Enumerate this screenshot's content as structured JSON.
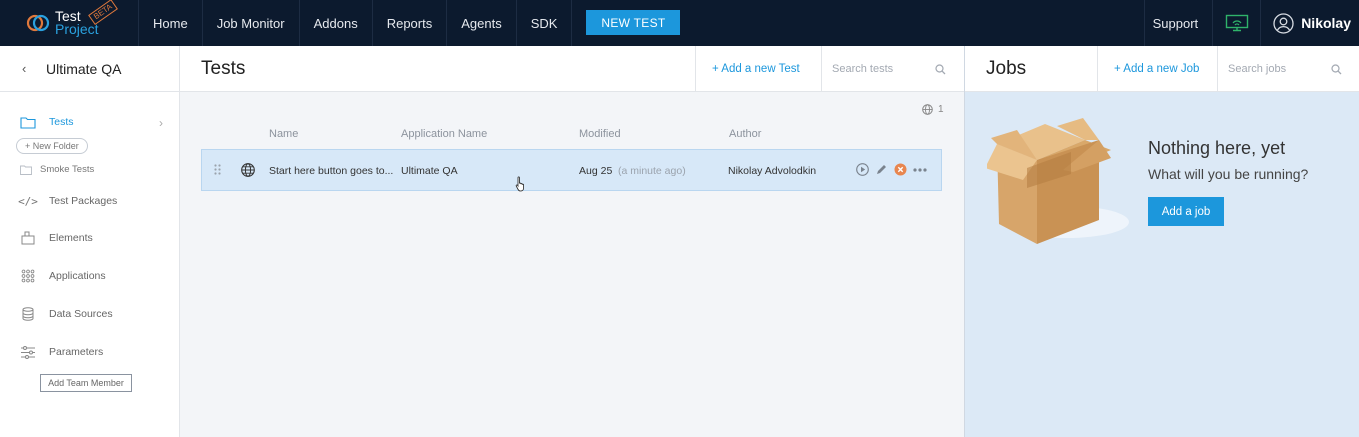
{
  "brand": {
    "line1": "Test",
    "line2": "Project",
    "badge": "BETA"
  },
  "nav": {
    "items": [
      "Home",
      "Job Monitor",
      "Addons",
      "Reports",
      "Agents",
      "SDK"
    ],
    "new_test": "NEW TEST",
    "support": "Support",
    "user": "Nikolay"
  },
  "sidebar": {
    "project": "Ultimate QA",
    "tests": "Tests",
    "new_folder": "+ New Folder",
    "smoke": "Smoke Tests",
    "test_packages": "Test Packages",
    "elements": "Elements",
    "applications": "Applications",
    "data_sources": "Data Sources",
    "parameters": "Parameters",
    "add_team": "Add Team Member"
  },
  "tests": {
    "title": "Tests",
    "add": "+  Add a new Test",
    "search_placeholder": "Search tests",
    "count": "1",
    "columns": {
      "name": "Name",
      "app": "Application Name",
      "modified": "Modified",
      "author": "Author"
    },
    "rows": [
      {
        "name": "Start here button goes to...",
        "app": "Ultimate QA",
        "modified": "Aug 25",
        "modified_rel": "(a minute ago)",
        "author": "Nikolay Advolodkin"
      }
    ]
  },
  "jobs": {
    "title": "Jobs",
    "add": "+  Add a new Job",
    "search_placeholder": "Search jobs",
    "empty_title": "Nothing here, yet",
    "empty_sub": "What will you be running?",
    "add_job": "Add a job"
  },
  "colors": {
    "accent": "#1c97dc",
    "topbar": "#0c1a2e",
    "row_selected": "#d7e8f8",
    "jobs_bg": "#dce9f6"
  },
  "icons": [
    "logo-icon",
    "monitor-icon",
    "user-icon",
    "folder-icon",
    "code-icon",
    "elements-icon",
    "grid-icon",
    "database-icon",
    "sliders-icon",
    "search-icon",
    "globe-icon",
    "drag-icon",
    "play-icon",
    "pencil-icon",
    "delete-icon",
    "more-icon",
    "box-illustration"
  ]
}
